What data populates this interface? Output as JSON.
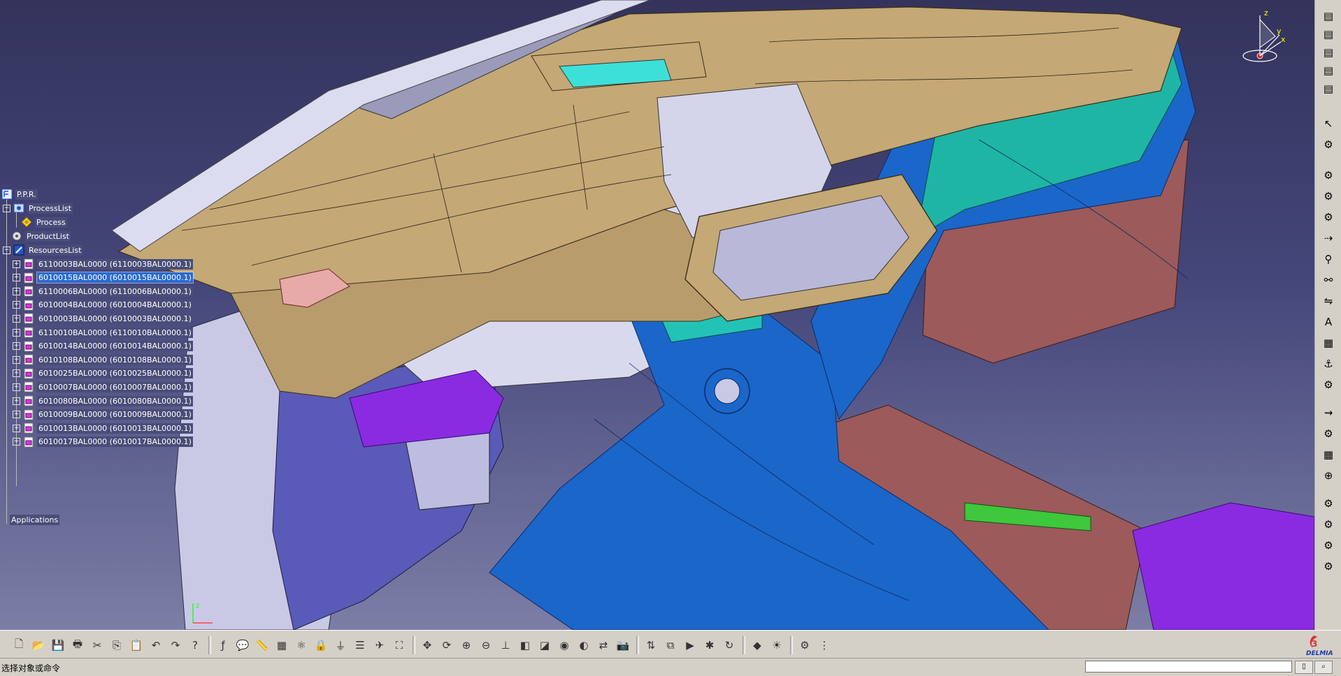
{
  "tree": {
    "root": "P.P.R.",
    "process_list": "ProcessList",
    "process": "Process",
    "product_list": "ProductList",
    "resources_list": "ResourcesList",
    "resources": [
      "6110003BAL0000 (6110003BAL0000.1)",
      "6010015BAL0000 (6010015BAL0000.1)",
      "6110006BAL0000 (6110006BAL0000.1)",
      "6010004BAL0000 (6010004BAL0000.1)",
      "6010003BAL0000 (6010003BAL0000.1)",
      "6110010BAL0000 (6110010BAL0000.1)",
      "6010014BAL0000 (6010014BAL0000.1)",
      "6010108BAL0000 (6010108BAL0000.1)",
      "6010025BAL0000 (6010025BAL0000.1)",
      "6010007BAL0000 (6010007BAL0000.1)",
      "6010080BAL0000 (6010080BAL0000.1)",
      "6010009BAL0000 (6010009BAL0000.1)",
      "6010013BAL0000 (6010013BAL0000.1)",
      "6010017BAL0000 (6010017BAL0000.1)"
    ],
    "selected_index": 1,
    "applications": "Applications"
  },
  "compass": {
    "x_label": "x",
    "y_label": "y",
    "z_label": "z"
  },
  "status": {
    "prompt": "选择对象或命令",
    "command_value": ""
  },
  "brand": "DELMIA",
  "colors": {
    "background_top": "#33335c",
    "background_bottom": "#7c7ea6",
    "dashboard_tan": "#c4a876",
    "console_blue": "#1b66c9",
    "trim_teal": "#1fb5a4",
    "panel_lavender": "#c9c9e6",
    "maroon": "#9c5a5a",
    "purple": "#8a2be2",
    "selection": "#2b6bd1"
  },
  "bottom_toolbar_icons": [
    "new-icon",
    "open-icon",
    "save-icon",
    "print-icon",
    "cut-icon",
    "copy-icon",
    "paste-icon",
    "undo-icon",
    "redo-icon",
    "whats-this-icon",
    "formula-icon",
    "knowledge-icon",
    "measure-icon",
    "table-icon",
    "catalog-icon",
    "lock-icon",
    "plug-icon",
    "analysis-icon",
    "fly-icon",
    "fit-all-icon",
    "pan-icon",
    "rotate-icon",
    "zoom-in-icon",
    "zoom-out-icon",
    "normal-view-icon",
    "iso-view-icon",
    "cube-view-icon",
    "view-mode-icon",
    "hide-show-icon",
    "swap-space-icon",
    "capture-icon",
    "shuffle-icon",
    "scene-icon",
    "simulation-icon",
    "clash-icon",
    "cycle-icon",
    "material-icon",
    "render-icon",
    "ppr-icon",
    "network-icon"
  ],
  "right_toolbar_icons": [
    "product-1-icon",
    "product-2-icon",
    "product-3-icon",
    "product-4-icon",
    "product-5-icon",
    "select-icon",
    "snap-icon",
    "device-1-icon",
    "device-2-icon",
    "device-3-icon",
    "insert-icon",
    "link-icon",
    "joint-icon",
    "mechanism-icon",
    "text-icon",
    "layout-icon",
    "fasten-icon",
    "robot-icon",
    "path-icon",
    "teach-icon",
    "grid-icon",
    "target-icon",
    "hardware-1-icon",
    "hardware-2-icon",
    "hardware-3-icon",
    "hardware-4-icon"
  ]
}
